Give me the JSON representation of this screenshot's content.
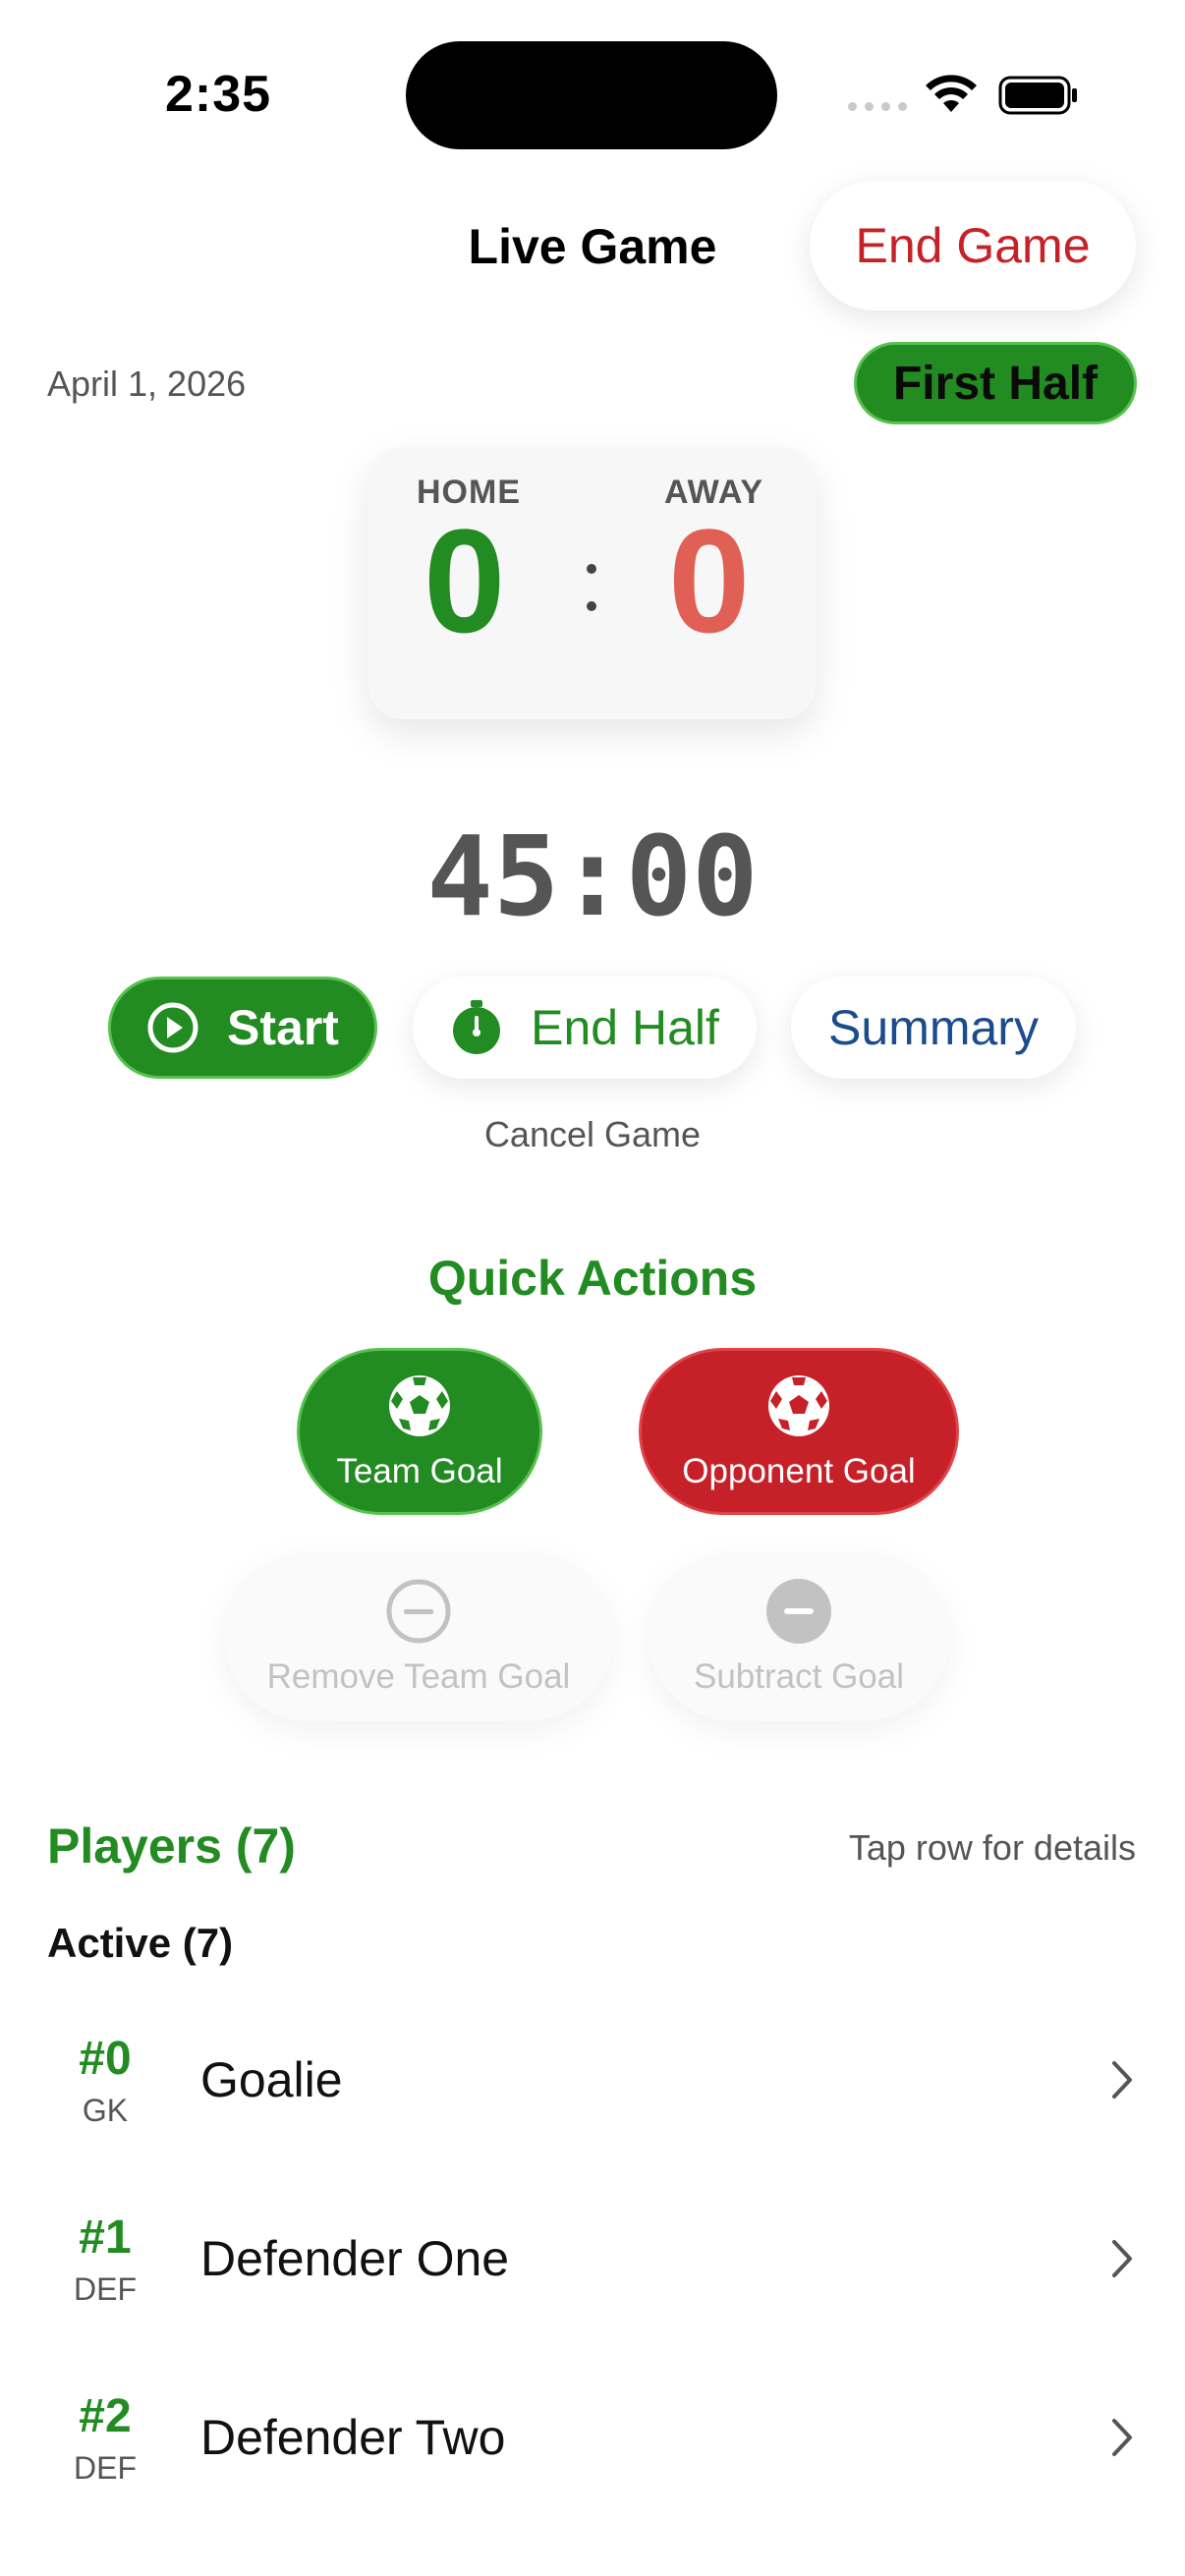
{
  "status_bar": {
    "time": "2:35"
  },
  "nav": {
    "title": "Live Game",
    "end_game_label": "End Game"
  },
  "game": {
    "date": "April 1, 2026",
    "period": "First Half"
  },
  "scoreboard": {
    "home_label": "HOME",
    "away_label": "AWAY",
    "home_score": "0",
    "away_score": "0",
    "home_color": "#228b22",
    "away_color": "#e06055"
  },
  "clock": "45:00",
  "controls": {
    "start_label": "Start",
    "start_icon": "play-circle-icon",
    "end_half_label": "End Half",
    "end_half_icon": "stopwatch-icon",
    "summary_label": "Summary",
    "cancel_label": "Cancel Game"
  },
  "quick_actions": {
    "title": "Quick Actions",
    "team_goal": "Team Goal",
    "opponent_goal": "Opponent Goal",
    "remove_team_goal": "Remove Team Goal",
    "subtract_goal": "Subtract Goal"
  },
  "players": {
    "title": "Players (7)",
    "hint": "Tap row for details",
    "active_title": "Active (7)",
    "items": [
      {
        "number": "#0",
        "position": "GK",
        "name": "Goalie"
      },
      {
        "number": "#1",
        "position": "DEF",
        "name": "Defender One"
      },
      {
        "number": "#2",
        "position": "DEF",
        "name": "Defender Two"
      }
    ]
  },
  "colors": {
    "accent_green": "#228b22",
    "danger_red": "#c62128",
    "link_blue": "#1b4d8c"
  }
}
